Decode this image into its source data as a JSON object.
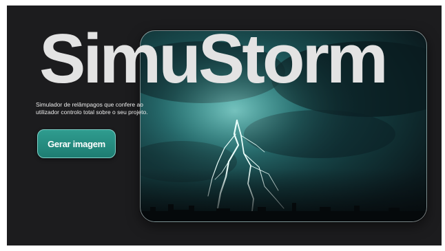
{
  "hero": {
    "title": "SimuStorm",
    "subtitle_line1": "Simulador de relâmpagos que confere ao",
    "subtitle_line2": "utilizador controlo total sobre o seu projeto."
  },
  "actions": {
    "generate_label": "Gerar imagem"
  },
  "colors": {
    "background": "#1c1c1e",
    "title": "#e3e3e3",
    "button": "#2a8f83",
    "button_border": "#7fcfc6"
  },
  "image": {
    "subject": "lightning-storm-photo"
  }
}
